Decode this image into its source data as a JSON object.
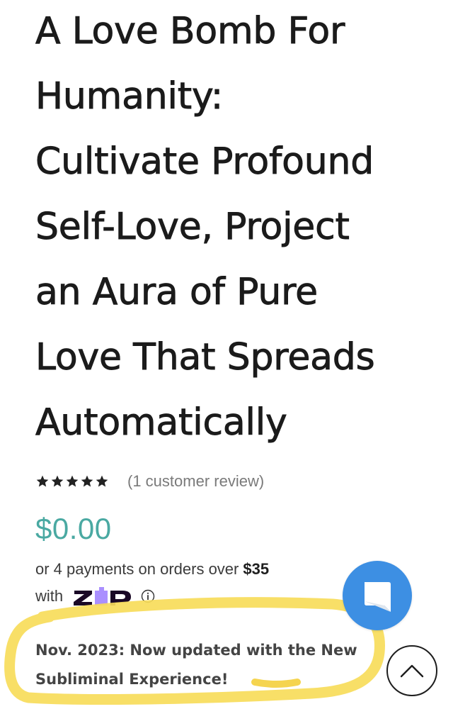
{
  "product": {
    "title": "A Love Bomb For\nHumanity:\nCultivate Profound\nSelf-Love, Project\nan Aura of Pure\nLove That Spreads\nAutomatically",
    "rating": 5,
    "rating_max": 5,
    "review_link": "(1 customer review)",
    "price": "$0.00",
    "price_color": "#4aa9a2"
  },
  "payment": {
    "line1_prefix": "or 4 payments on orders over",
    "line1_amount": "$35",
    "line2_prefix": "with",
    "provider_logo_text": "ZIP",
    "provider_logo_color": "#1a0826",
    "provider_logo_accent": "#aa8fff",
    "info_icon": "info-circle-icon"
  },
  "note": {
    "text": "Nov. 2023: Now updated with the New Subliminal Experience!",
    "highlight_color": "#f7dc5a"
  },
  "floating": {
    "chat_icon": "chat-bubble-icon",
    "chat_color": "#3d8fe3",
    "scroll_top_icon": "chevron-up-icon"
  }
}
